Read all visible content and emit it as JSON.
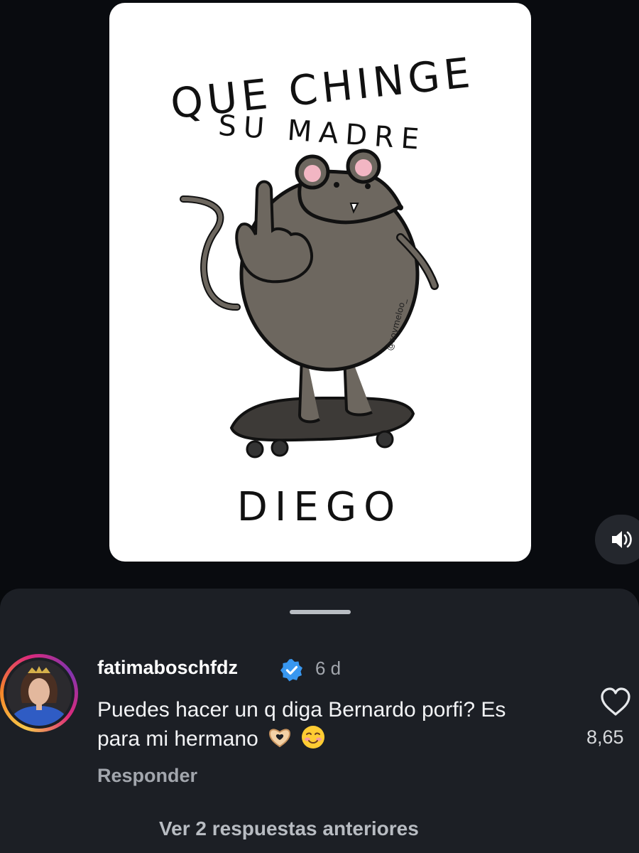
{
  "post": {
    "artwork": {
      "line1": "QUE CHINGE",
      "line2": "SU MADRE",
      "name": "DIEGO",
      "signature": "@soymeloo_"
    }
  },
  "controls": {
    "sound_icon": "speaker-on-icon"
  },
  "comment": {
    "username": "fatimaboschfdz",
    "verified": true,
    "time": "6 d",
    "text": "Puedes hacer un q diga Bernardo porfi? Es para mi hermano",
    "emojis": [
      "heart-hands-emoji",
      "smiling-face-emoji"
    ],
    "reply_label": "Responder",
    "likes": "8,65",
    "view_replies": "Ver 2 respuestas anteriores"
  },
  "colors": {
    "background": "#07090c",
    "sheet": "#1c1f25",
    "verified": "#3897f0",
    "muted_text": "#a2a6ad"
  }
}
